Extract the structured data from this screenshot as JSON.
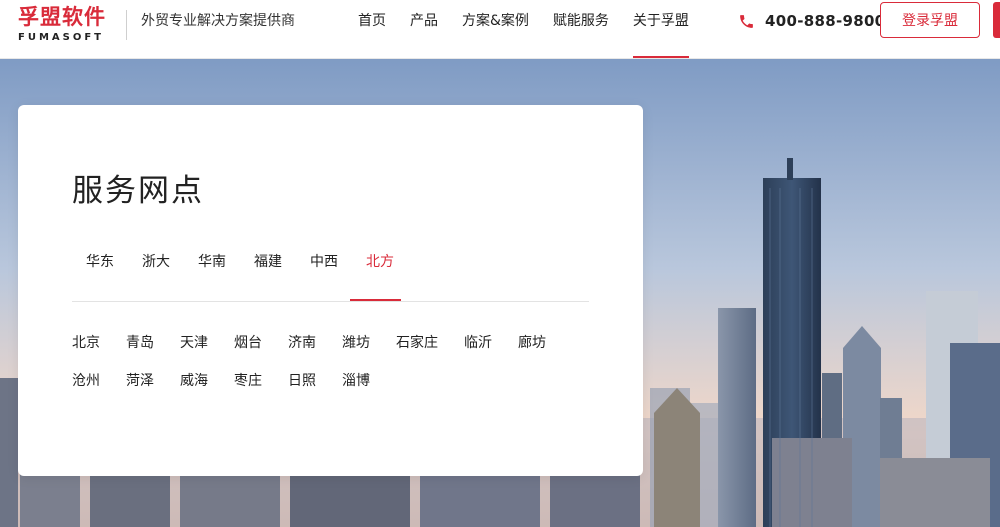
{
  "header": {
    "logo_cn": "孚盟软件",
    "logo_en": "FUMASOFT",
    "tagline": "外贸专业解决方案提供商",
    "nav": [
      "首页",
      "产品",
      "方案&案例",
      "赋能服务",
      "关于孚盟"
    ],
    "active_nav": "关于孚盟",
    "phone": "400-888-9800",
    "login_label": "登录孚盟"
  },
  "card": {
    "title": "服务网点",
    "tabs": [
      "华东",
      "浙大",
      "华南",
      "福建",
      "中西",
      "北方"
    ],
    "active_tab": "北方",
    "cities_row1": [
      "北京",
      "青岛",
      "天津",
      "烟台",
      "济南",
      "潍坊",
      "石家庄",
      "临沂",
      "廊坊"
    ],
    "cities_row2": [
      "沧州",
      "菏泽",
      "威海",
      "枣庄",
      "日照",
      "淄博"
    ]
  },
  "colors": {
    "accent": "#d92b3a",
    "text": "#222222",
    "sky_top": "#7f9bc4",
    "sky_bottom": "#f3d8c8"
  },
  "icons": {
    "phone": "phone-icon"
  }
}
